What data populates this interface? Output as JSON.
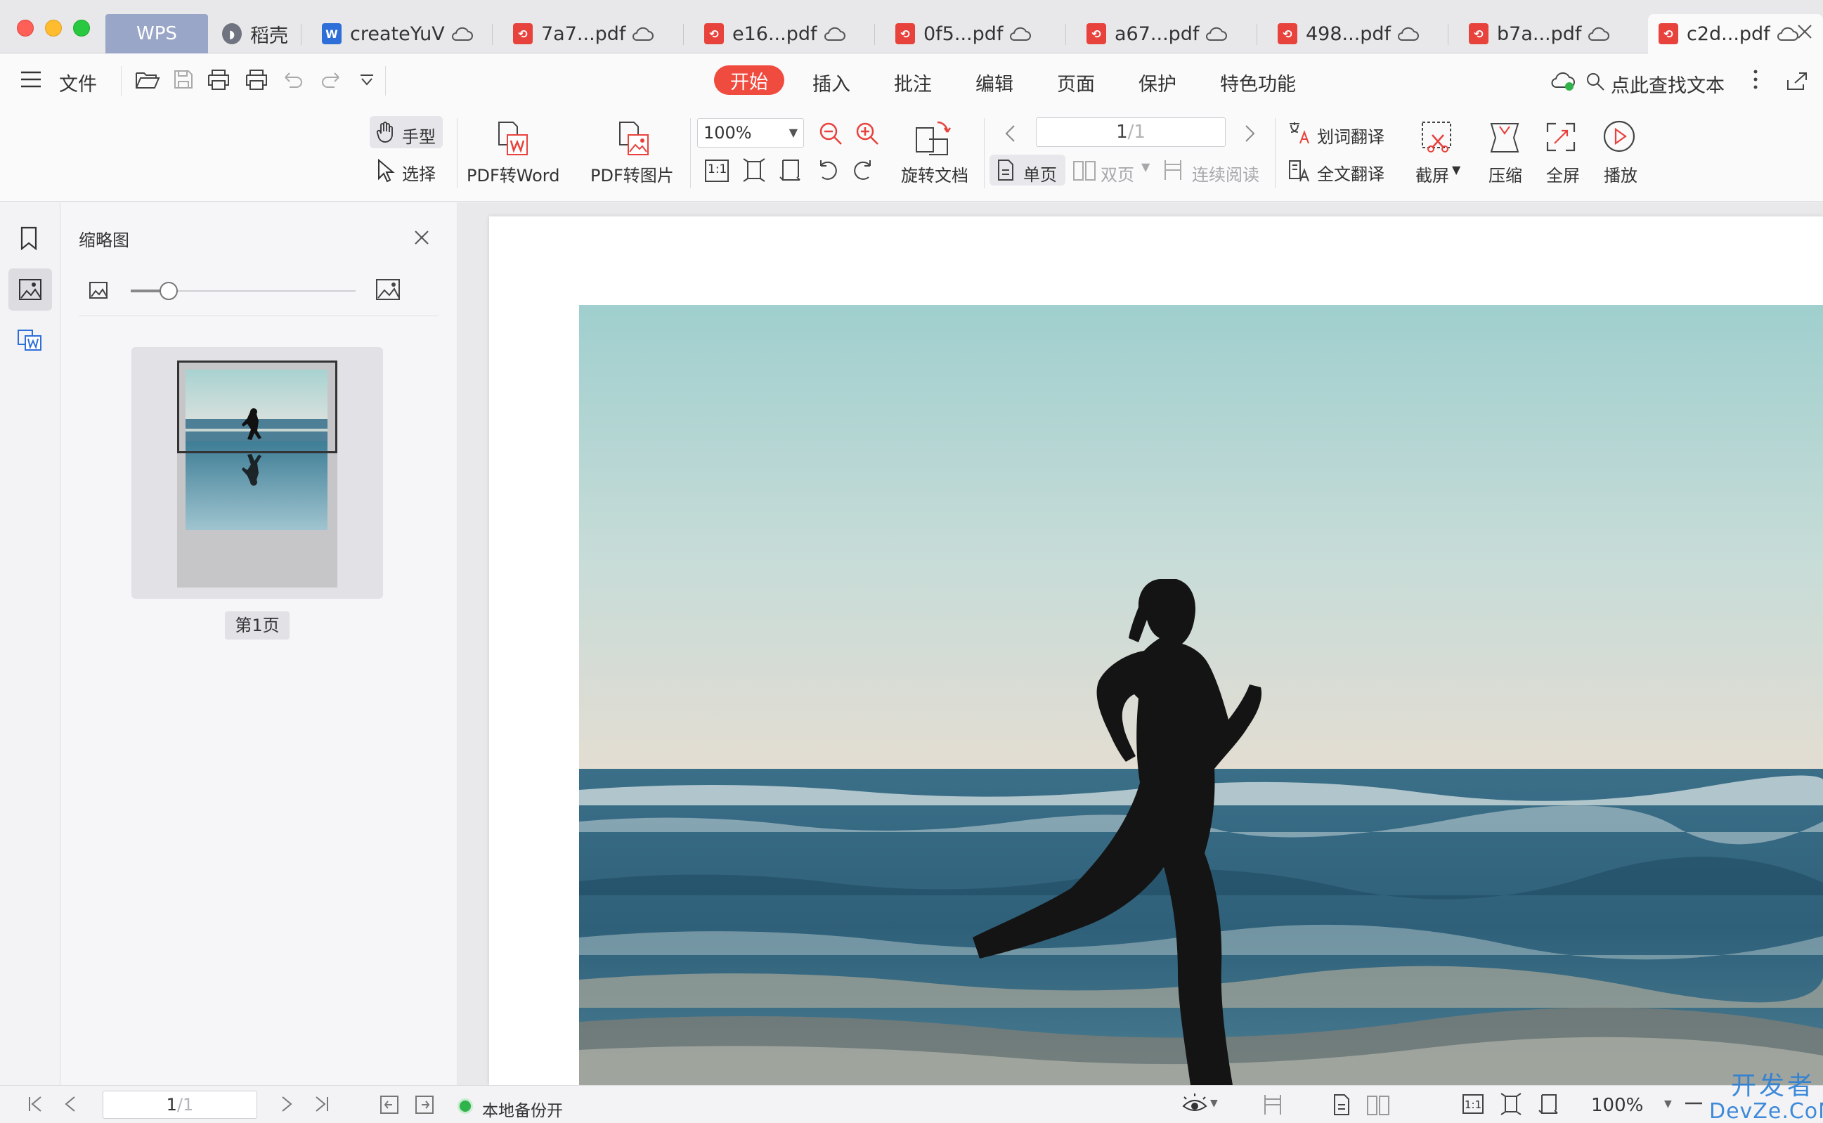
{
  "window": {
    "traffic_lights": [
      "close",
      "minimize",
      "maximize"
    ]
  },
  "tabs": {
    "wps_label": "WPS",
    "items": [
      {
        "label": "稻壳",
        "type": "dao",
        "cloud": false
      },
      {
        "label": "createYuV",
        "type": "word",
        "cloud": true
      },
      {
        "label": "7a7...pdf",
        "type": "pdf",
        "cloud": true
      },
      {
        "label": "e16...pdf",
        "type": "pdf",
        "cloud": true
      },
      {
        "label": "0f5...pdf",
        "type": "pdf",
        "cloud": true
      },
      {
        "label": "a67...pdf",
        "type": "pdf",
        "cloud": true
      },
      {
        "label": "498...pdf",
        "type": "pdf",
        "cloud": true
      },
      {
        "label": "b7a...pdf",
        "type": "pdf",
        "cloud": true
      },
      {
        "label": "c2d...pdf",
        "type": "pdf",
        "cloud": true,
        "active": true
      }
    ]
  },
  "menubar": {
    "file_label": "文件",
    "tabs": [
      "开始",
      "插入",
      "批注",
      "编辑",
      "页面",
      "保护",
      "特色功能"
    ],
    "active_tab": "开始",
    "search_label": "点此查找文本"
  },
  "ribbon": {
    "hand_label": "手型",
    "select_label": "选择",
    "pdf_to_word_label": "PDF转Word",
    "pdf_to_image_label": "PDF转图片",
    "zoom_value": "100%",
    "rotate_doc_label": "旋转文档",
    "page_current": "1",
    "page_total": "/1",
    "single_page_label": "单页",
    "double_page_label": "双页",
    "continuous_label": "连续阅读",
    "word_translate_label": "划词翻译",
    "full_translate_label": "全文翻译",
    "screenshot_label": "截屏",
    "compress_label": "压缩",
    "fullscreen_label": "全屏",
    "play_label": "播放",
    "actual_size_label": "1:1"
  },
  "thumbnail_panel": {
    "title": "缩略图",
    "page_label": "第1页",
    "slider_value": 0.15
  },
  "statusbar": {
    "page_current": "1",
    "page_total": "/1",
    "backup_label": "本地备份开",
    "zoom_value": "100%",
    "actual_size_label": "1:1"
  },
  "watermark": {
    "line1": "开发者",
    "line2": "DevZe.CoM"
  },
  "colors": {
    "accent_red": "#f04b3f",
    "pdf_icon": "#e8423c",
    "word_icon": "#2e6ed8",
    "backup_green": "#2fb34a",
    "watermark_blue": "#2a7fd6"
  }
}
